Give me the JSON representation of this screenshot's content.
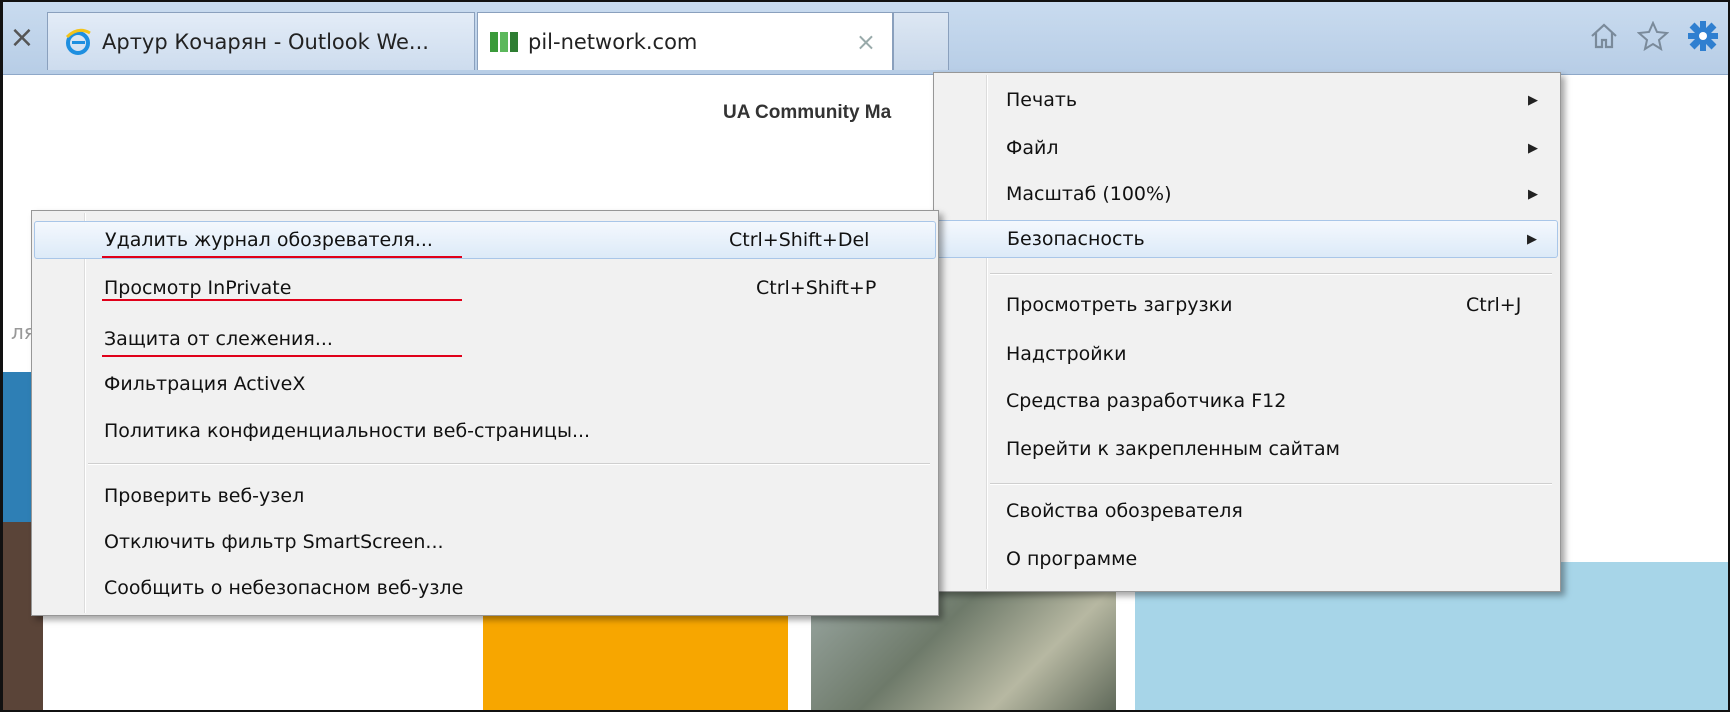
{
  "tabs": {
    "inactive_tab_title": "Артур Кочарян - Outlook We...",
    "active_tab_title": "pil-network.com",
    "close_glyph": "×"
  },
  "toolbar_icons": [
    "home-icon",
    "star-icon",
    "gear-icon"
  ],
  "page": {
    "header_text": "UA Community Ma",
    "left_stub_text": "ля"
  },
  "tools_menu": {
    "items": [
      {
        "label": "Печать",
        "submenu": true
      },
      {
        "label": "Файл",
        "submenu": true
      },
      {
        "label": "Масштаб (100%)",
        "submenu": true
      },
      {
        "label": "Безопасность",
        "submenu": true,
        "highlighted": true
      },
      {
        "label": "Просмотреть загрузки",
        "shortcut": "Ctrl+J"
      },
      {
        "label": "Надстройки"
      },
      {
        "label": "Средства разработчика F12"
      },
      {
        "label": "Перейти к закрепленным сайтам"
      },
      {
        "label": "Свойства обозревателя"
      },
      {
        "label": "О программе"
      }
    ]
  },
  "safety_menu": {
    "items": [
      {
        "label": "Удалить журнал обозревателя...",
        "shortcut": "Ctrl+Shift+Del",
        "highlighted": true,
        "marked": true
      },
      {
        "label": "Просмотр InPrivate",
        "shortcut": "Ctrl+Shift+P",
        "marked": true
      },
      {
        "label": "Защита от слежения...",
        "marked": true
      },
      {
        "label": "Фильтрация ActiveX"
      },
      {
        "label": "Политика конфиденциальности веб-страницы..."
      },
      {
        "label": "Проверить веб-узел"
      },
      {
        "label": "Отключить фильтр SmartScreen..."
      },
      {
        "label": "Сообщить о небезопасном веб-узле"
      }
    ]
  },
  "colors": {
    "annotation_underline": "#e0001a",
    "menu_highlight": "#dceaf8",
    "tabbar": "#c9dbef"
  }
}
